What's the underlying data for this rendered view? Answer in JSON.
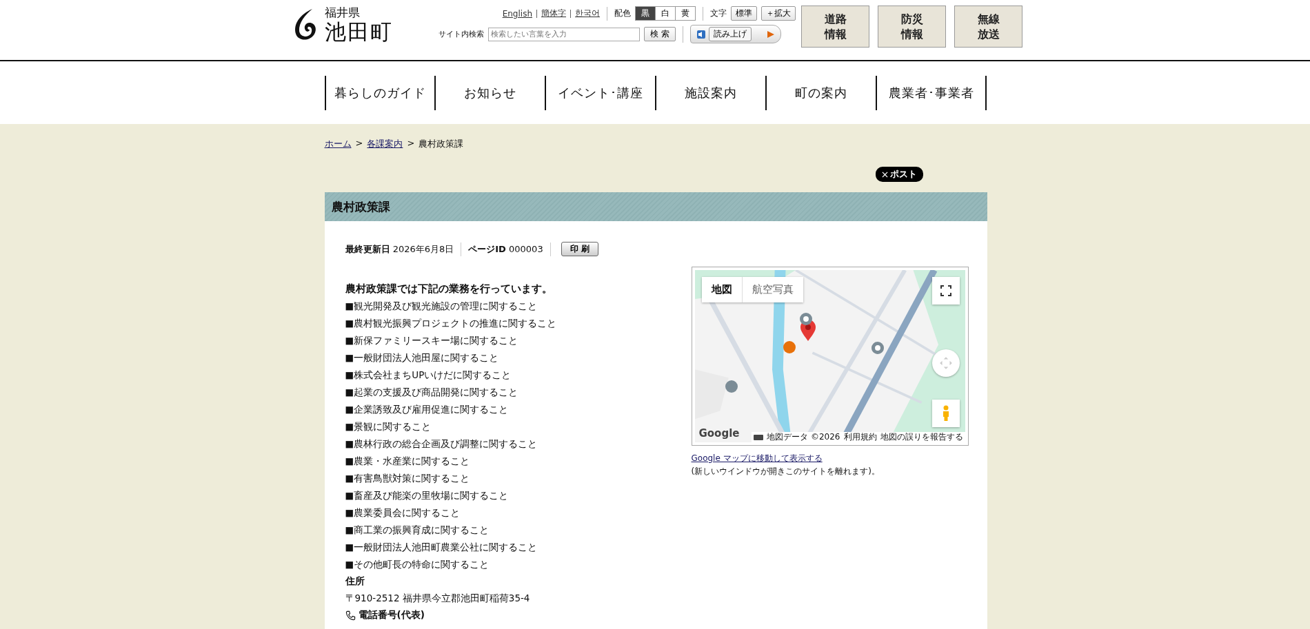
{
  "header": {
    "logo": {
      "prefecture": "福井県",
      "town": "池田町"
    },
    "languages": [
      {
        "label": "English"
      },
      {
        "label": "簡体字"
      },
      {
        "label": "한국어"
      }
    ],
    "color_scheme": {
      "label": "配色",
      "options": [
        {
          "label": "黒",
          "selected": true
        },
        {
          "label": "白",
          "selected": false
        },
        {
          "label": "黄",
          "selected": false
        }
      ]
    },
    "text_size": {
      "label": "文字",
      "buttons": [
        "標準",
        "＋拡大"
      ]
    },
    "search": {
      "label": "サイト内検索",
      "placeholder": "検索したい言葉を入力",
      "button": "検 索"
    },
    "read_aloud": {
      "label": "読み上げ"
    },
    "quick_buttons": [
      {
        "line1": "道路",
        "line2": "情報"
      },
      {
        "line1": "防災",
        "line2": "情報"
      },
      {
        "line1": "無線",
        "line2": "放送"
      }
    ]
  },
  "nav": [
    "暮らしのガイド",
    "お知らせ",
    "イベント･講座",
    "施設案内",
    "町の案内",
    "農業者･事業者"
  ],
  "breadcrumb": [
    {
      "kind": "link",
      "label": "ホーム"
    },
    {
      "kind": "separator",
      "label": ">"
    },
    {
      "kind": "link",
      "label": "各課案内"
    },
    {
      "kind": "separator",
      "label": ">"
    },
    {
      "kind": "current",
      "label": "農村政策課"
    }
  ],
  "share": {
    "label": "ポスト"
  },
  "page": {
    "title": "農村政策課",
    "meta": {
      "updated_label": "最終更新日",
      "updated": "2026年6月8日",
      "id_label": "ページID",
      "id": "000003",
      "print": "印 刷"
    },
    "intro": "農村政策課では下記の業務を行っています。",
    "duties": [
      "■観光開発及び観光施設の管理に関すること",
      "■農村観光振興プロジェクトの推進に関すること",
      "■新保ファミリースキー場に関すること",
      "■一般財団法人池田屋に関すること",
      "■株式会社まちUPいけだに関すること",
      "■起業の支援及び商品開発に関すること",
      "■企業誘致及び雇用促進に関すること",
      "■景観に関すること",
      "■農林行政の総合企画及び調整に関すること",
      "■農業・水産業に関すること",
      "■有害鳥獣対策に関すること",
      "■畜産及び能楽の里牧場に関すること",
      "■農業委員会に関すること",
      "■商工業の振興育成に関すること",
      "■一般財団法人池田町農業公社に関すること",
      "■その他町長の特命に関すること"
    ],
    "address_label": "住所",
    "address": "〒910-2512 福井県今立郡池田町稲荷35-4",
    "phone_label": "電話番号(代表)"
  },
  "map": {
    "tabs": [
      {
        "label": "地図",
        "selected": true
      },
      {
        "label": "航空写真",
        "selected": false
      }
    ],
    "logo": "Google",
    "attribution": [
      "地図データ ©2026",
      "利用規約",
      "地図の誤りを報告する"
    ],
    "link": "Google マップに移動して表示する",
    "note": "(新しいウインドウが開きこのサイトを離れます)。"
  }
}
